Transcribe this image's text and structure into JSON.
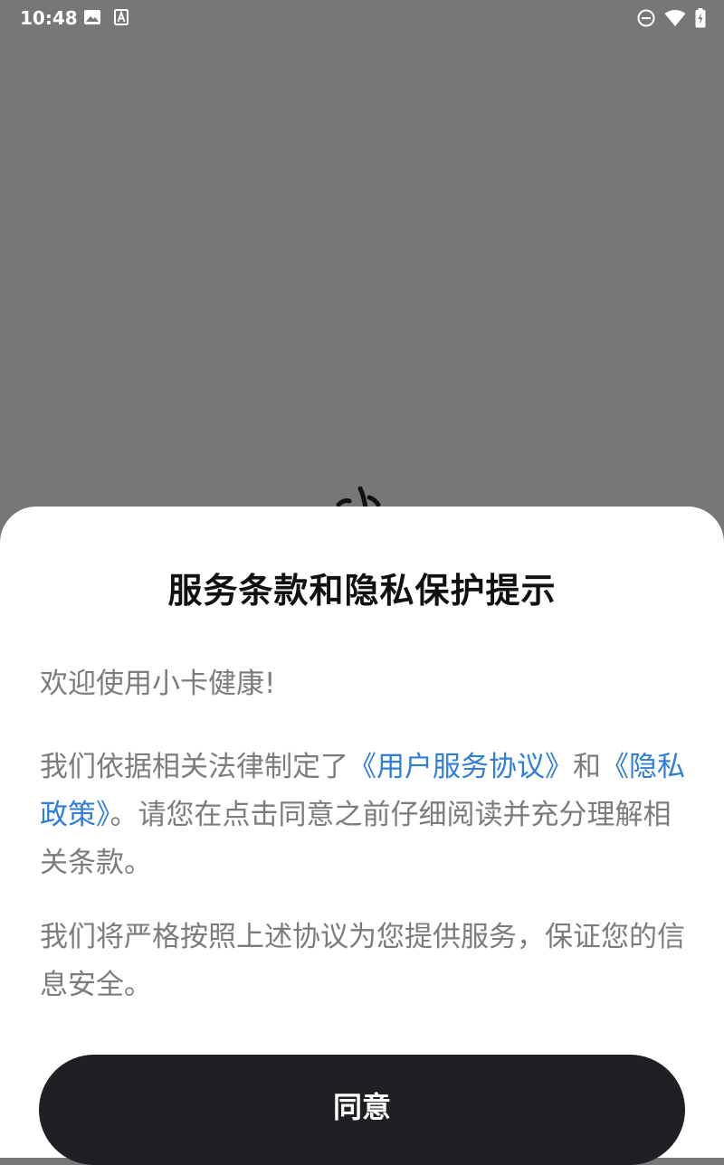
{
  "status_bar": {
    "time": "10:48",
    "left_icons": [
      "image-icon",
      "text-a-icon"
    ],
    "right_icons": [
      "do-not-disturb-icon",
      "wifi-icon",
      "battery-charging-icon"
    ]
  },
  "dialog": {
    "title": "服务条款和隐私保护提示",
    "welcome": "欢迎使用小卡健康!",
    "para2_prefix": "我们依据相关法律制定了",
    "link_user_agreement": "《用户服务协议》",
    "para2_and": "和",
    "link_privacy_policy": "《隐私政策》",
    "para2_suffix": "。请您在点击同意之前仔细阅读并充分理解相关条款。",
    "para3": "我们将严格按照上述协议为您提供服务，保证您的信息安全。",
    "agree_label": "同意"
  },
  "colors": {
    "scrim": "#777777",
    "sheet": "#ffffff",
    "title": "#111111",
    "body_text": "#7c7c7c",
    "link": "#2f7ed8",
    "button": "#1f2023",
    "button_text": "#ffffff"
  }
}
